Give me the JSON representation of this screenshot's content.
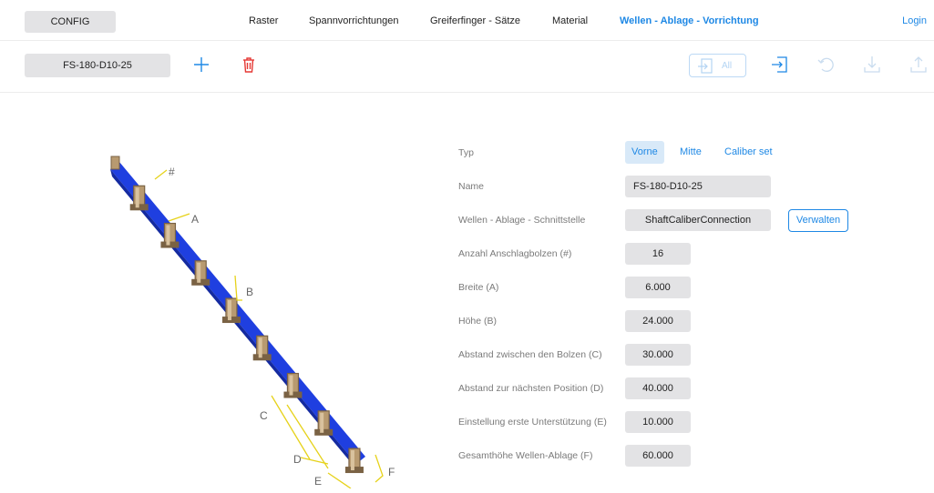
{
  "nav": {
    "config": "CONFIG",
    "items": [
      "Raster",
      "Spannvorrichtungen",
      "Greiferfinger - Sätze",
      "Material",
      "Wellen - Ablage - Vorrichtung"
    ],
    "active_index": 4,
    "login": "Login"
  },
  "toolbar": {
    "selected": "FS-180-D10-25",
    "all_label": "All",
    "icons": [
      "plus-icon",
      "trash-icon",
      "import-all-icon",
      "import-icon",
      "undo-icon",
      "download-icon",
      "export-icon"
    ]
  },
  "form": {
    "typ_label": "Typ",
    "typ_options": [
      "Vorne",
      "Mitte",
      "Caliber set"
    ],
    "typ_selected": "Vorne",
    "name_label": "Name",
    "name_value": "FS-180-D10-25",
    "iface_label": "Wellen - Ablage - Schnittstelle",
    "iface_value": "ShaftCaliberConnection",
    "verwalten": "Verwalten",
    "rows": [
      {
        "label": "Anzahl Anschlagbolzen (#)",
        "value": "16"
      },
      {
        "label": "Breite (A)",
        "value": "6.000"
      },
      {
        "label": "Höhe (B)",
        "value": "24.000"
      },
      {
        "label": "Abstand zwischen den Bolzen (C)",
        "value": "30.000"
      },
      {
        "label": "Abstand zur nächsten Position (D)",
        "value": "40.000"
      },
      {
        "label": "Einstellung erste Unterstützung (E)",
        "value": "10.000"
      },
      {
        "label": "Gesamthöhe Wellen-Ablage (F)",
        "value": "60.000"
      }
    ]
  },
  "viewer": {
    "dim_labels": [
      "#",
      "A",
      "B",
      "C",
      "D",
      "E",
      "F"
    ],
    "colors": {
      "rail": "#1f3fe0",
      "rail_dark": "#142aa0",
      "bolt": "#b89a70",
      "bolt_dark": "#7a6244",
      "dim": "#e6d21a"
    }
  }
}
